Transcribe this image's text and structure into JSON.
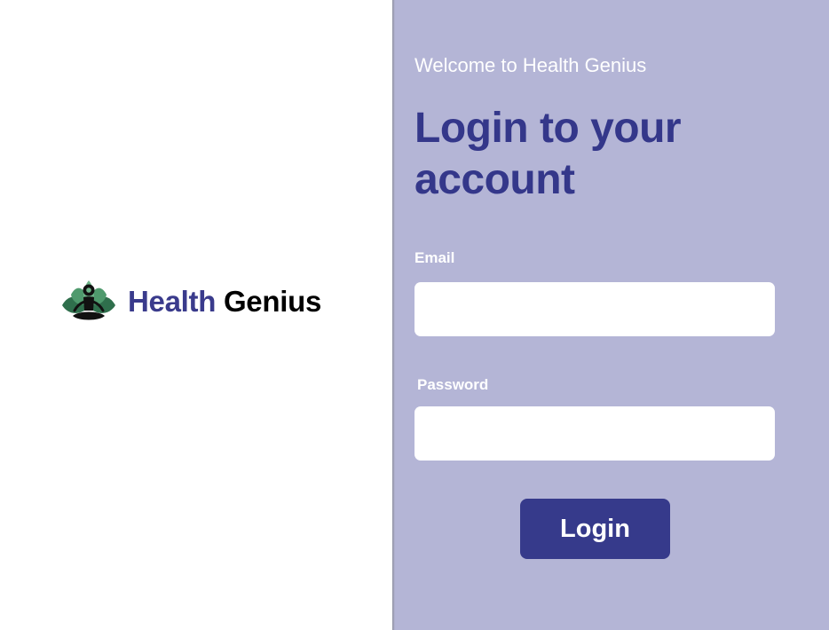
{
  "brand": {
    "name_part_1": "Health",
    "name_part_2": "Genius",
    "logo_icon": "meditating-person-lotus-icon",
    "colors": {
      "name_part_1": "#3a3b8c",
      "name_part_2": "#000000",
      "lotus": "#3f8a5f"
    }
  },
  "login_panel": {
    "welcome_text": "Welcome to Health Genius",
    "headline": "Login to your account",
    "email": {
      "label": "Email",
      "value": "",
      "placeholder": ""
    },
    "password": {
      "label": "Password",
      "value": "",
      "placeholder": ""
    },
    "login_button_label": "Login",
    "colors": {
      "panel_background": "#b4b5d6",
      "headline": "#34378a",
      "button": "#363a8b"
    }
  }
}
